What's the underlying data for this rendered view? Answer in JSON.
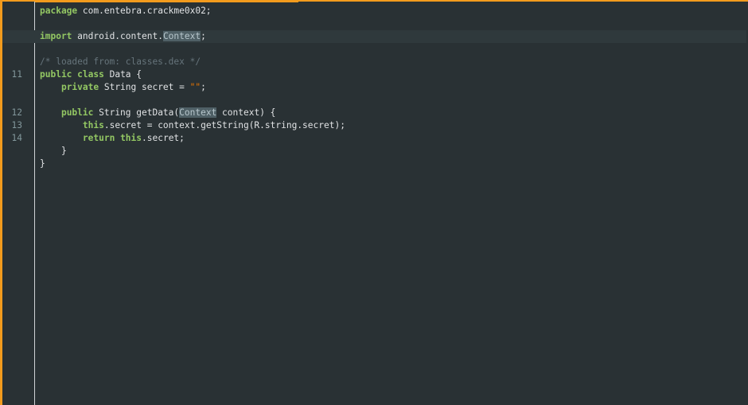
{
  "editor": {
    "lines": [
      {
        "n": "",
        "segs": [
          {
            "t": "package",
            "c": "kw"
          },
          {
            "t": " com.entebra.crackme0x02;",
            "c": ""
          }
        ]
      },
      {
        "n": "",
        "segs": []
      },
      {
        "n": "",
        "current": true,
        "segs": [
          {
            "t": "import",
            "c": "kw"
          },
          {
            "t": " android.content.",
            "c": ""
          },
          {
            "t": "Context",
            "c": "hl"
          },
          {
            "t": ";",
            "c": ""
          }
        ]
      },
      {
        "n": "",
        "segs": []
      },
      {
        "n": "",
        "segs": [
          {
            "t": "/* loaded from: classes.dex */",
            "c": "cm"
          }
        ]
      },
      {
        "n": "11",
        "segs": [
          {
            "t": "public",
            "c": "kw"
          },
          {
            "t": " ",
            "c": ""
          },
          {
            "t": "class",
            "c": "kw"
          },
          {
            "t": " Data {",
            "c": ""
          }
        ]
      },
      {
        "n": "",
        "segs": [
          {
            "t": "    ",
            "c": ""
          },
          {
            "t": "private",
            "c": "kw"
          },
          {
            "t": " String secret = ",
            "c": ""
          },
          {
            "t": "\"\"",
            "c": "str"
          },
          {
            "t": ";",
            "c": ""
          }
        ]
      },
      {
        "n": "",
        "segs": []
      },
      {
        "n": "12",
        "segs": [
          {
            "t": "    ",
            "c": ""
          },
          {
            "t": "public",
            "c": "kw"
          },
          {
            "t": " String getData(",
            "c": ""
          },
          {
            "t": "Context",
            "c": "hl"
          },
          {
            "t": " context) {",
            "c": ""
          }
        ]
      },
      {
        "n": "13",
        "segs": [
          {
            "t": "        ",
            "c": ""
          },
          {
            "t": "this",
            "c": "kw"
          },
          {
            "t": ".secret = context.getString(R.string.secret);",
            "c": ""
          }
        ]
      },
      {
        "n": "14",
        "segs": [
          {
            "t": "        ",
            "c": ""
          },
          {
            "t": "return",
            "c": "kw"
          },
          {
            "t": " ",
            "c": ""
          },
          {
            "t": "this",
            "c": "kw"
          },
          {
            "t": ".secret;",
            "c": ""
          }
        ]
      },
      {
        "n": "",
        "segs": [
          {
            "t": "    }",
            "c": ""
          }
        ]
      },
      {
        "n": "",
        "segs": [
          {
            "t": "}",
            "c": ""
          }
        ]
      }
    ]
  },
  "colors": {
    "background": "#293134",
    "keyword": "#93c763",
    "comment": "#66747b",
    "string": "#ec7600",
    "accent": "#f29b1d",
    "highlight": "#4f6066"
  }
}
